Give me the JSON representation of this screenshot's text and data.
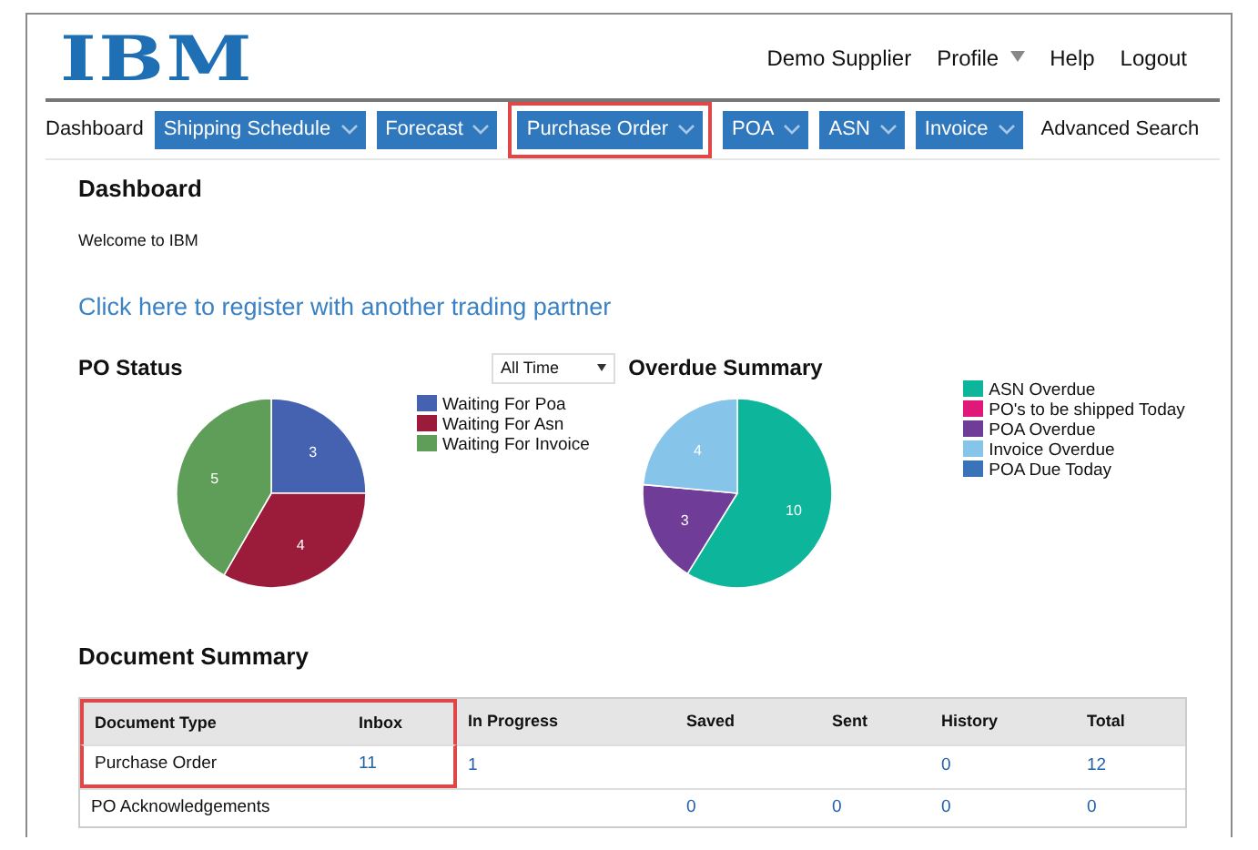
{
  "header": {
    "logo": "IBM",
    "links": [
      {
        "label": "Demo Supplier",
        "dropdown": false
      },
      {
        "label": "Profile",
        "dropdown": true
      },
      {
        "label": "Help",
        "dropdown": false
      },
      {
        "label": "Logout",
        "dropdown": false
      }
    ]
  },
  "nav": [
    {
      "label": "Dashboard",
      "kind": "plain",
      "highlighted": false
    },
    {
      "label": "Shipping Schedule",
      "kind": "menu",
      "highlighted": false
    },
    {
      "label": "Forecast",
      "kind": "menu",
      "highlighted": false
    },
    {
      "label": "Purchase Order",
      "kind": "menu",
      "highlighted": true
    },
    {
      "label": "POA",
      "kind": "menu",
      "highlighted": false
    },
    {
      "label": "ASN",
      "kind": "menu",
      "highlighted": false
    },
    {
      "label": "Invoice",
      "kind": "menu",
      "highlighted": false
    },
    {
      "label": "Advanced Search",
      "kind": "plain",
      "highlighted": false
    }
  ],
  "title": "Dashboard",
  "welcome": "Welcome to IBM",
  "register_link": "Click here to register with another trading partner",
  "po_status": {
    "title": "PO Status",
    "period": "All Time",
    "chart_data": {
      "type": "pie",
      "categories": [
        "Waiting For Poa",
        "Waiting For Asn",
        "Waiting For Invoice"
      ],
      "data_labels": true,
      "values": [
        3,
        4,
        5
      ],
      "colors": [
        "#4562b0",
        "#9b1b3b",
        "#5f9e59"
      ]
    }
  },
  "overdue_summary": {
    "title": "Overdue Summary",
    "chart_data": {
      "type": "pie",
      "categories": [
        "ASN Overdue",
        "PO's to be shipped Today",
        "POA Overdue",
        "Invoice Overdue",
        "POA Due Today"
      ],
      "data_labels": true,
      "values": [
        10,
        0,
        3,
        4,
        0
      ],
      "colors": [
        "#0db69b",
        "#e0187a",
        "#6f3c97",
        "#86c4ea",
        "#3b73b9"
      ]
    }
  },
  "document_summary": {
    "title": "Document Summary",
    "columns": [
      {
        "label": "Document Type",
        "highlighted": true
      },
      {
        "label": "Inbox",
        "highlighted": true
      },
      {
        "label": "In Progress",
        "highlighted": false
      },
      {
        "label": "Saved",
        "highlighted": false
      },
      {
        "label": "Sent",
        "highlighted": false
      },
      {
        "label": "History",
        "highlighted": false
      },
      {
        "label": "Total",
        "highlighted": false
      }
    ],
    "rows": [
      {
        "highlighted": true,
        "cells": [
          "Purchase Order",
          "11",
          "1",
          "",
          "",
          "0",
          "12"
        ]
      },
      {
        "highlighted": false,
        "cells": [
          "PO Acknowledgements",
          "",
          "",
          "0",
          "0",
          "0",
          "0"
        ]
      }
    ]
  }
}
